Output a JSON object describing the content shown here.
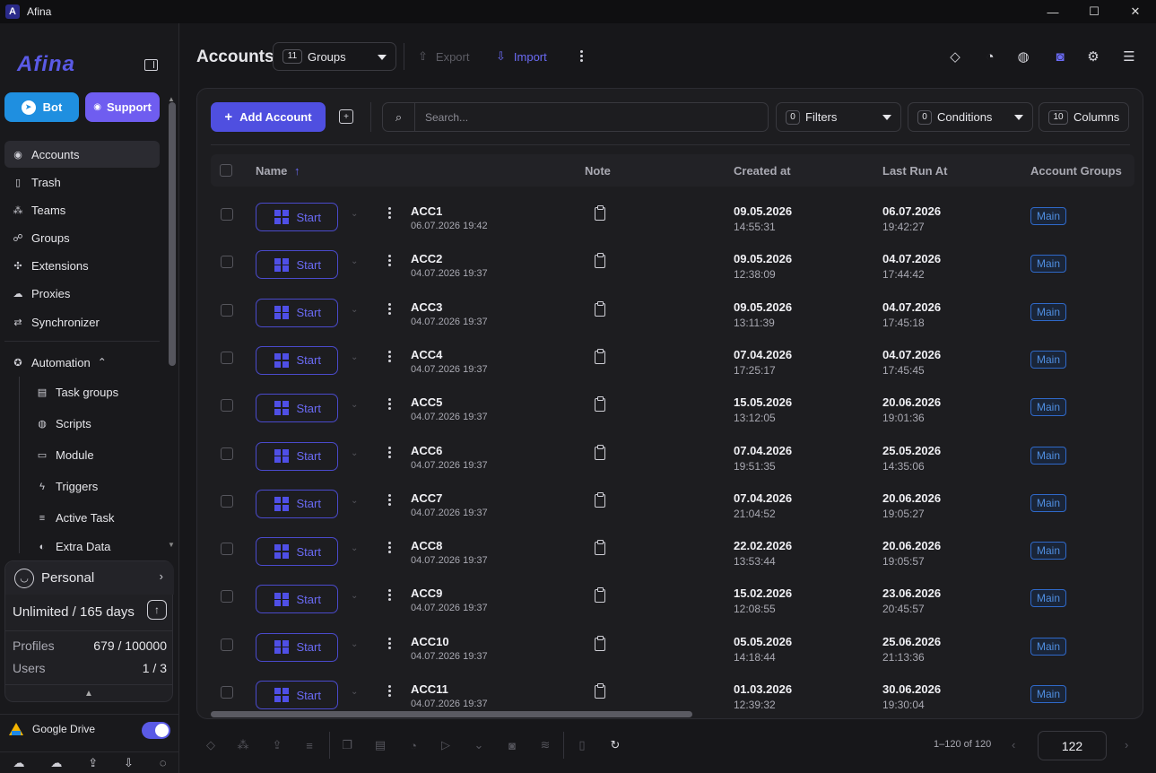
{
  "window": {
    "title": "Afina",
    "controls": [
      "—",
      "☐",
      "✕"
    ]
  },
  "sidebar": {
    "logo": "Afina",
    "bot_label": "Bot",
    "support_label": "Support",
    "nav": [
      {
        "label": "Accounts",
        "icon": "user-circle-icon",
        "glyph": "◉"
      },
      {
        "label": "Trash",
        "icon": "trash-icon",
        "glyph": "▯"
      },
      {
        "label": "Teams",
        "icon": "team-icon",
        "glyph": "⁂"
      },
      {
        "label": "Groups",
        "icon": "groups-icon",
        "glyph": "☍"
      },
      {
        "label": "Extensions",
        "icon": "puzzle-icon",
        "glyph": "✣"
      },
      {
        "label": "Proxies",
        "icon": "cloud-icon",
        "glyph": "☁"
      },
      {
        "label": "Synchronizer",
        "icon": "sync-icon",
        "glyph": "⇄"
      }
    ],
    "automation": {
      "label": "Automation",
      "chevron": "⌃",
      "items": [
        {
          "label": "Task groups",
          "icon": "list-icon",
          "glyph": "▤"
        },
        {
          "label": "Scripts",
          "icon": "github-icon",
          "glyph": "◍"
        },
        {
          "label": "Module",
          "icon": "terminal-icon",
          "glyph": "▭"
        },
        {
          "label": "Triggers",
          "icon": "bolt-icon",
          "glyph": "ϟ"
        },
        {
          "label": "Active Task",
          "icon": "playlist-icon",
          "glyph": "≡"
        },
        {
          "label": "Extra Data",
          "icon": "globe-icon",
          "glyph": "◐"
        }
      ]
    },
    "plan": {
      "profile": "Personal",
      "term": "Unlimited / 165 days",
      "profiles_label": "Profiles",
      "profiles_value": "679 / 100000",
      "users_label": "Users",
      "users_value": "1 / 3"
    },
    "google_drive_label": "Google Drive",
    "bottom_icons": [
      "☁",
      "☁",
      "⇪",
      "⇩",
      "◌"
    ]
  },
  "header": {
    "title": "Accounts",
    "groups_count": "11",
    "groups_label": "Groups",
    "export_label": "Export",
    "import_label": "Import"
  },
  "toolbar": {
    "add_label": "Add Account",
    "search_placeholder": "Search...",
    "filters_count": "0",
    "filters_label": "Filters",
    "conditions_count": "0",
    "conditions_label": "Conditions",
    "columns_count": "10",
    "columns_label": "Columns"
  },
  "table": {
    "headers": {
      "name": "Name",
      "note": "Note",
      "created": "Created at",
      "last_run": "Last Run At",
      "groups": "Account Groups"
    },
    "sort_arrow": "↑",
    "start_label": "Start",
    "group_badge": "Main",
    "rows": [
      {
        "name": "ACC1",
        "updated": "06.07.2026 19:42",
        "created_date": "09.05.2026",
        "created_time": "14:55:31",
        "run_date": "06.07.2026",
        "run_time": "19:42:27"
      },
      {
        "name": "ACC2",
        "updated": "04.07.2026 19:37",
        "created_date": "09.05.2026",
        "created_time": "12:38:09",
        "run_date": "04.07.2026",
        "run_time": "17:44:42"
      },
      {
        "name": "ACC3",
        "updated": "04.07.2026 19:37",
        "created_date": "09.05.2026",
        "created_time": "13:11:39",
        "run_date": "04.07.2026",
        "run_time": "17:45:18"
      },
      {
        "name": "ACC4",
        "updated": "04.07.2026 19:37",
        "created_date": "07.04.2026",
        "created_time": "17:25:17",
        "run_date": "04.07.2026",
        "run_time": "17:45:45"
      },
      {
        "name": "ACC5",
        "updated": "04.07.2026 19:37",
        "created_date": "15.05.2026",
        "created_time": "13:12:05",
        "run_date": "20.06.2026",
        "run_time": "19:01:36"
      },
      {
        "name": "ACC6",
        "updated": "04.07.2026 19:37",
        "created_date": "07.04.2026",
        "created_time": "19:51:35",
        "run_date": "25.05.2026",
        "run_time": "14:35:06"
      },
      {
        "name": "ACC7",
        "updated": "04.07.2026 19:37",
        "created_date": "07.04.2026",
        "created_time": "21:04:52",
        "run_date": "20.06.2026",
        "run_time": "19:05:27"
      },
      {
        "name": "ACC8",
        "updated": "04.07.2026 19:37",
        "created_date": "22.02.2026",
        "created_time": "13:53:44",
        "run_date": "20.06.2026",
        "run_time": "19:05:57"
      },
      {
        "name": "ACC9",
        "updated": "04.07.2026 19:37",
        "created_date": "15.02.2026",
        "created_time": "12:08:55",
        "run_date": "23.06.2026",
        "run_time": "20:45:57"
      },
      {
        "name": "ACC10",
        "updated": "04.07.2026 19:37",
        "created_date": "05.05.2026",
        "created_time": "14:18:44",
        "run_date": "25.06.2026",
        "run_time": "21:13:36"
      },
      {
        "name": "ACC11",
        "updated": "04.07.2026 19:37",
        "created_date": "01.03.2026",
        "created_time": "12:39:32",
        "run_date": "30.06.2026",
        "run_time": "19:30:04"
      }
    ]
  },
  "footer": {
    "range_text": "1–120 of 120",
    "page_size": "122"
  },
  "colors": {
    "accent": "#4f4fe0",
    "bot": "#1f8fe0",
    "support": "#6f5df0",
    "badge": "#4f8ee0"
  }
}
